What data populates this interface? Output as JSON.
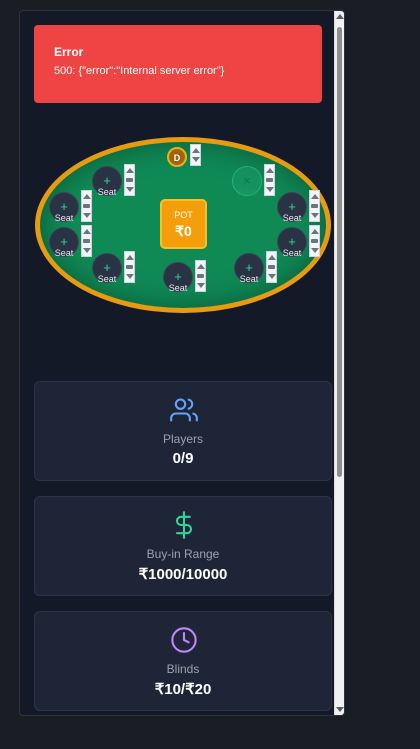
{
  "error": {
    "title": "Error",
    "message": "500: {\"error\":\"Internal server error\"}",
    "color": "#ef4444"
  },
  "table": {
    "pot_label": "POT",
    "pot_value": "₹0",
    "dealer_label": "D",
    "seat_label": "Seat",
    "add_symbol": "+",
    "taken_symbol": "×",
    "felt_color": "#0f8a55",
    "rail_color": "#e79b10"
  },
  "stats": {
    "players": {
      "label": "Players",
      "value": "0/9",
      "icon": "users-icon",
      "color": "#60a5fa"
    },
    "buyin": {
      "label": "Buy-in Range",
      "value": "₹1000/10000",
      "icon": "dollar-icon",
      "color": "#34d399"
    },
    "blinds": {
      "label": "Blinds",
      "value": "₹10/₹20",
      "icon": "clock-icon",
      "color": "#c084fc"
    }
  }
}
